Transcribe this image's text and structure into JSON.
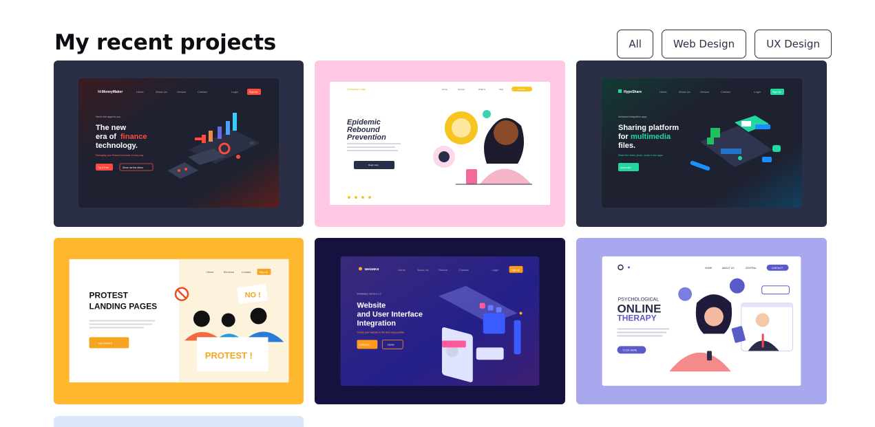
{
  "section": {
    "title": "My recent projects",
    "filters": [
      {
        "label": "All"
      },
      {
        "label": "Web Design"
      },
      {
        "label": "UX Design"
      }
    ]
  },
  "projects": [
    {
      "name": "MoneyMaker",
      "brand_prefix": "Mr.",
      "nav": [
        "Home",
        "About Us",
        "Service",
        "Contact"
      ],
      "login": "Login",
      "signup": "Sign Up",
      "eyebrow": "Here's the apps for you",
      "headline_1": "The new",
      "headline_2": "era of",
      "headline_accent": "finance",
      "headline_3": "technology.",
      "subtext": "Managing your finance business is easy way",
      "btn_primary": "Try it Free",
      "btn_secondary": "Show me the demo",
      "accent": "#ff4a3d"
    },
    {
      "logo": "Company Logo",
      "nav": [
        "Home",
        "Service",
        "What is",
        "FAQ"
      ],
      "nav_button": "Contact",
      "headline_1": "Epidemic",
      "headline_2": "Rebound",
      "headline_3": "Prevention",
      "button": "Read more",
      "accent": "#f6c520"
    },
    {
      "name": "HypeShare",
      "nav": [
        "Home",
        "About Us",
        "Service",
        "Contact"
      ],
      "login": "Login",
      "signup": "Sign Up",
      "eyebrow": "Advanced integration apps",
      "headline_1": "Sharing platform",
      "headline_2": "for",
      "headline_accent": "multimedia",
      "headline_3": "files.",
      "subtext": "Share the video, photo, audio in one apps",
      "button": "Subscribe",
      "accent": "#20d8a0"
    },
    {
      "nav": [
        "Home",
        "Services",
        "Contact"
      ],
      "nav_button": "Sign Up",
      "headline_1": "PROTEST",
      "headline_2": "LANDING PAGES",
      "button": "Get Started",
      "sign_no": "NO !",
      "banner": "PROTEST !",
      "accent": "#f5a41f"
    },
    {
      "name": "WebMKII",
      "nav": [
        "Home",
        "About Us",
        "Service",
        "Contact"
      ],
      "login": "Login",
      "signup": "Sign Up",
      "eyebrow": "WebMaker Version 1.0",
      "headline_1": "Website",
      "headline_2": "and User Interface",
      "headline_3": "Integration",
      "subtext": "Create your website in the best way possible",
      "btn_primary": "Subscribe",
      "btn_secondary": "Demo",
      "accent": "#ff9a1a"
    },
    {
      "nav": [
        "HOME",
        "ABOUT US",
        "CENTRAL"
      ],
      "nav_button": "CONTACT",
      "kicker": "PSYCHOLOGICAL",
      "headline_1": "ONLINE",
      "headline_2": "THERAPY",
      "button": "CLICK HERE",
      "accent": "#5a5bc8"
    }
  ]
}
